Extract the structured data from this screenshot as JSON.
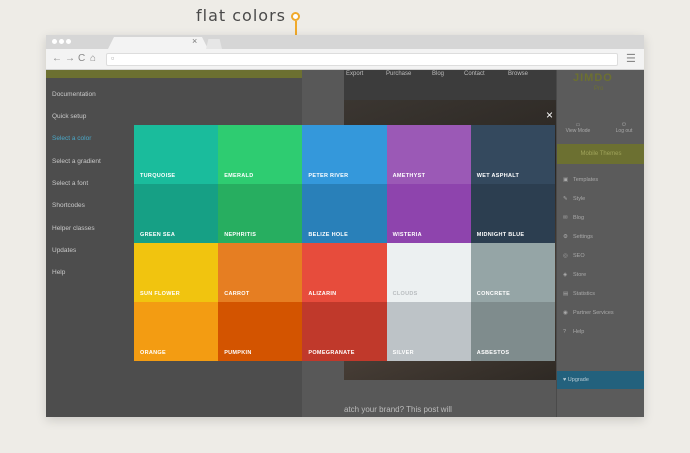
{
  "annotation": {
    "label": "flat colors"
  },
  "browser": {
    "tab_close": "×",
    "nav_icons": {
      "back": "←",
      "forward": "→",
      "reload": "C",
      "home": "⌂"
    },
    "menu_icon": "☰"
  },
  "site": {
    "nav_links": [
      "Export",
      "Purchase",
      "Blog",
      "Contact",
      "Browse"
    ],
    "caption": "atch your brand? This post will"
  },
  "docs_nav": {
    "items": [
      "Documentation",
      "Quick setup",
      "Select a color",
      "Select a gradient",
      "Select a font",
      "Shortcodes",
      "Helper classes",
      "Updates",
      "Help"
    ]
  },
  "jimdo": {
    "logo": "JIMDO",
    "sub": "Pro",
    "view_mode": "View Mode",
    "log_out": "Log out",
    "design": "Mobile Themes",
    "menu": [
      "Templates",
      "Style",
      "Blog",
      "Settings",
      "SEO",
      "Store",
      "Statistics",
      "Partner Services",
      "Help"
    ],
    "upgrade": "Upgrade"
  },
  "overlay": {
    "close": "×"
  },
  "swatches": [
    {
      "name": "TURQUOISE",
      "color": "#1abc9c"
    },
    {
      "name": "EMERALD",
      "color": "#2ecc71"
    },
    {
      "name": "PETER RIVER",
      "color": "#3498db"
    },
    {
      "name": "AMETHYST",
      "color": "#9b59b6"
    },
    {
      "name": "WET ASPHALT",
      "color": "#34495e"
    },
    {
      "name": "GREEN SEA",
      "color": "#16a085"
    },
    {
      "name": "NEPHRITIS",
      "color": "#27ae60"
    },
    {
      "name": "BELIZE HOLE",
      "color": "#2980b9"
    },
    {
      "name": "WISTERIA",
      "color": "#8e44ad"
    },
    {
      "name": "MIDNIGHT BLUE",
      "color": "#2c3e50"
    },
    {
      "name": "SUN FLOWER",
      "color": "#f1c40f"
    },
    {
      "name": "CARROT",
      "color": "#e67e22"
    },
    {
      "name": "ALIZARIN",
      "color": "#e74c3c"
    },
    {
      "name": "CLOUDS",
      "color": "#ecf0f1"
    },
    {
      "name": "CONCRETE",
      "color": "#95a5a6"
    },
    {
      "name": "ORANGE",
      "color": "#f39c12"
    },
    {
      "name": "PUMPKIN",
      "color": "#d35400"
    },
    {
      "name": "POMEGRANATE",
      "color": "#c0392b"
    },
    {
      "name": "SILVER",
      "color": "#bdc3c7"
    },
    {
      "name": "ASBESTOS",
      "color": "#7f8c8d"
    }
  ],
  "colors": {
    "accent": "#f0a92a",
    "jimdo_green": "#6c7031",
    "upgrade_blue": "#23617d",
    "active_link": "#4aa8c8"
  }
}
